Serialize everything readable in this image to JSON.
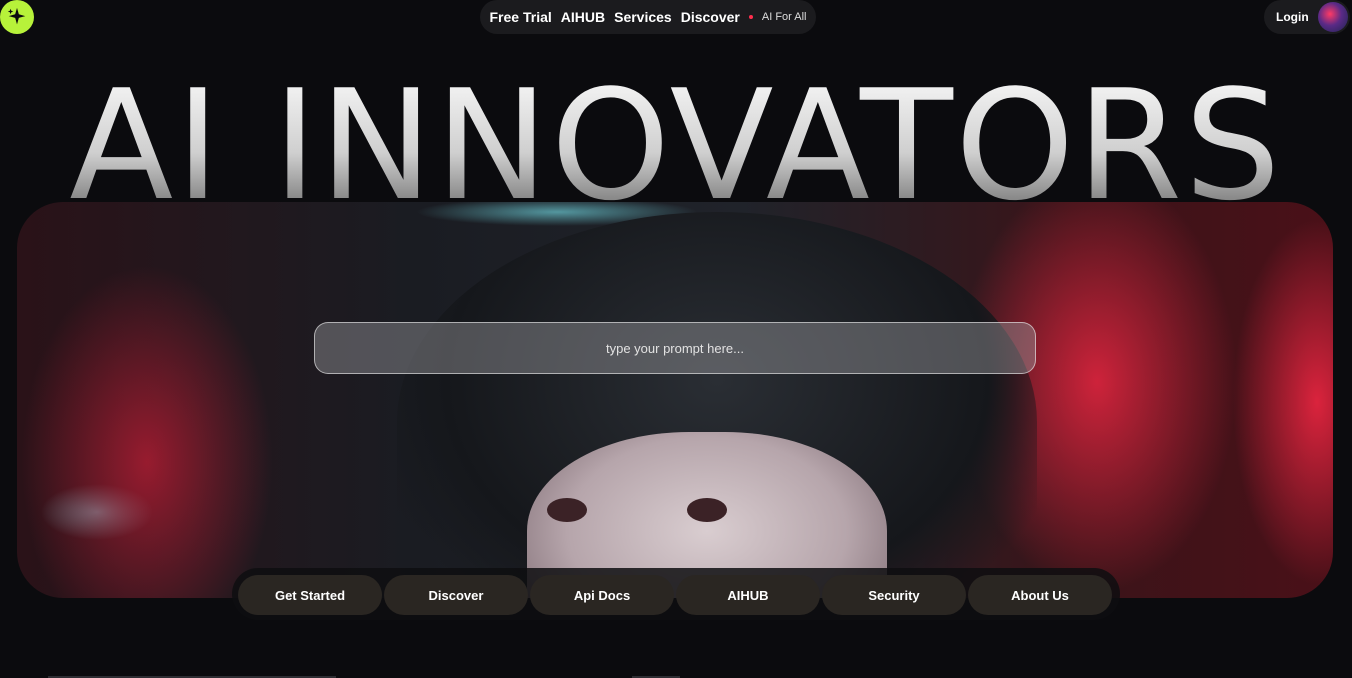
{
  "logo": {
    "icon": "sparkle-icon",
    "color": "#b7f23a"
  },
  "top_nav": {
    "items": [
      "Free Trial",
      "AIHUB",
      "Services",
      "Discover"
    ],
    "tagline": "AI For All",
    "dot_color": "#ff2e4d"
  },
  "account": {
    "login_label": "Login",
    "avatar_icon": "user-avatar"
  },
  "hero": {
    "title": "AI INNOVATORS",
    "prompt_placeholder": "type your prompt here..."
  },
  "bottom_tabs": [
    "Get Started",
    "Discover",
    "Api Docs",
    "AIHUB",
    "Security",
    "About Us"
  ],
  "colors": {
    "background": "#0b0b0e",
    "pill": "#1b1b1e",
    "tab": "#2a2622"
  }
}
